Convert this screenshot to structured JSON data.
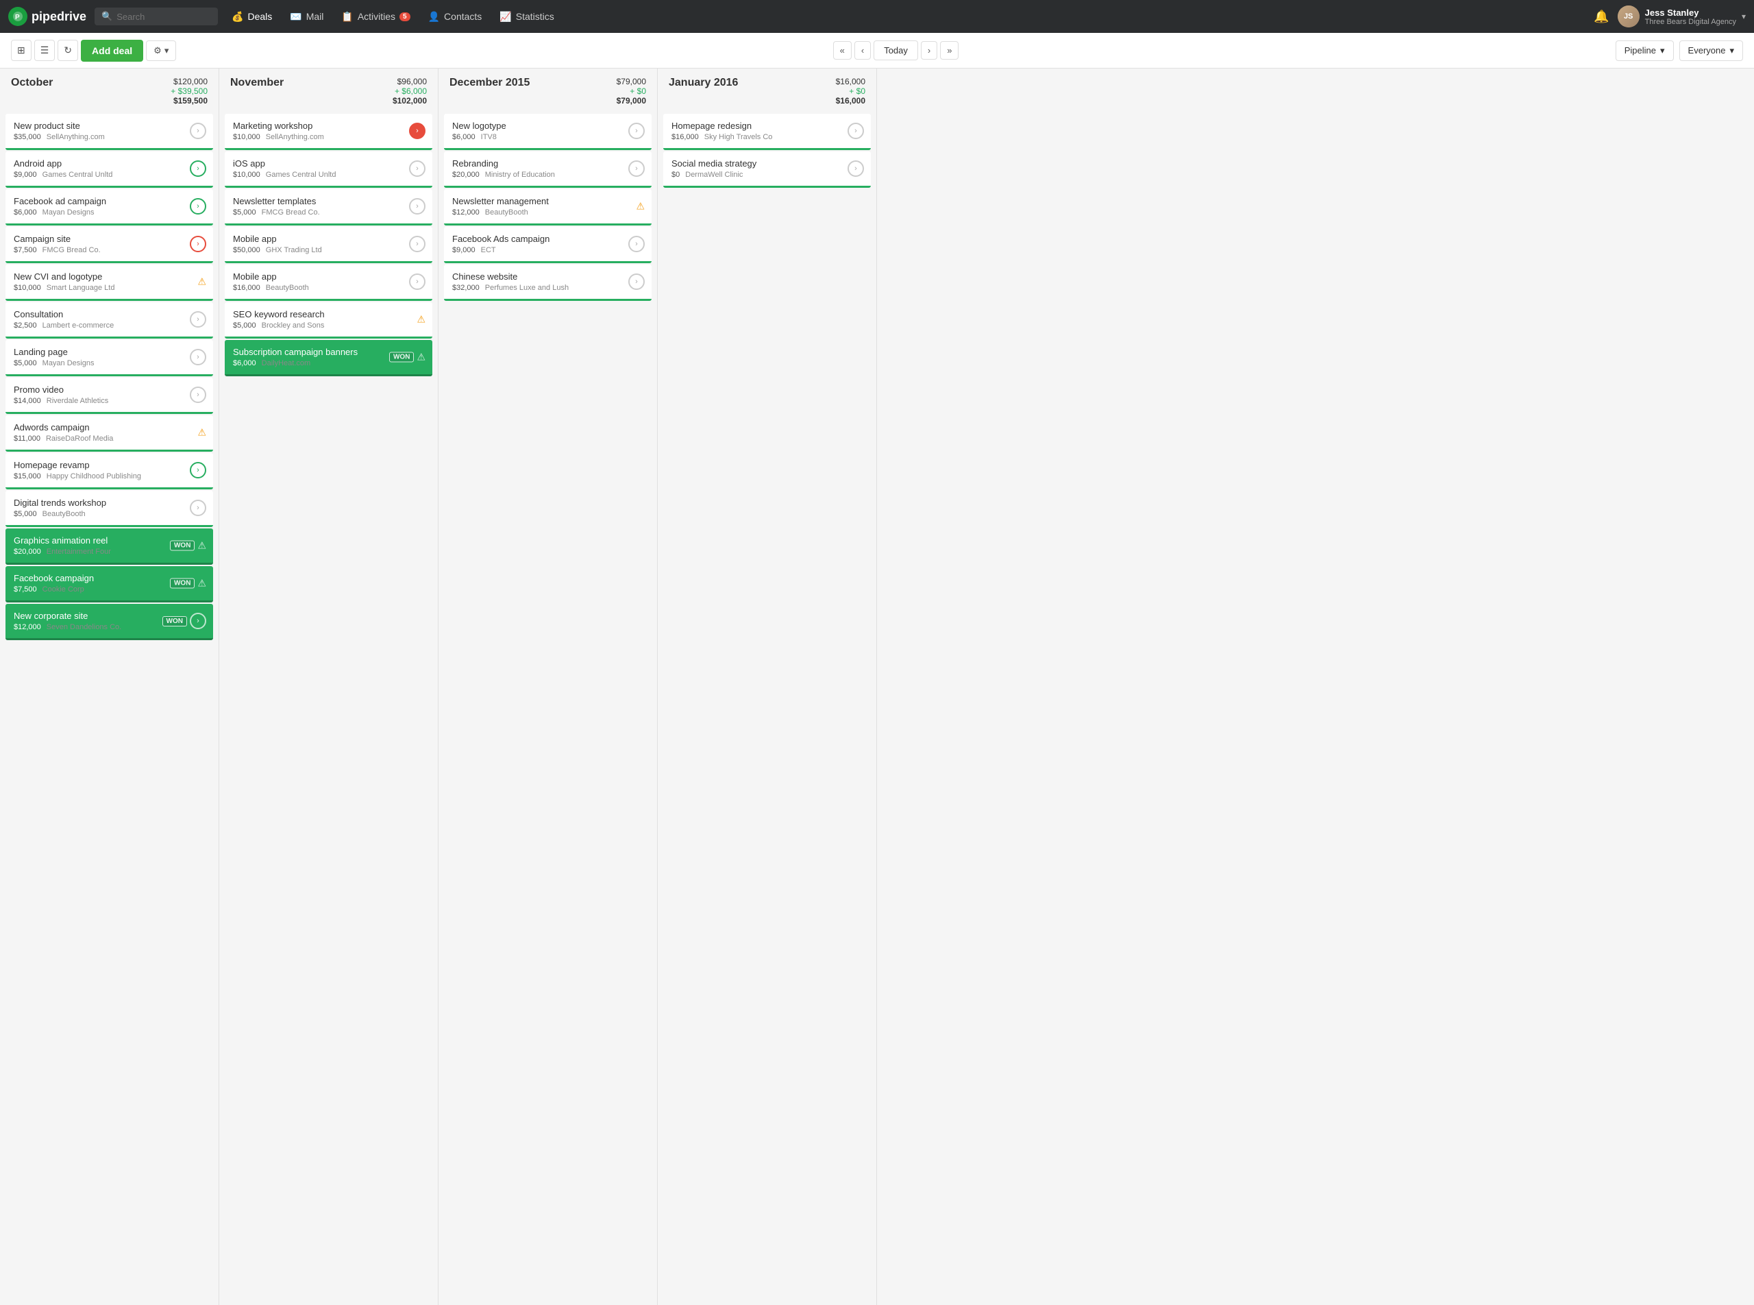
{
  "app": {
    "logo": "pipedrive",
    "logo_symbol": "P"
  },
  "nav": {
    "search_placeholder": "Search",
    "items": [
      {
        "id": "deals",
        "label": "Deals",
        "icon": "dollar-sign-icon",
        "active": true,
        "badge": null
      },
      {
        "id": "mail",
        "label": "Mail",
        "icon": "mail-icon",
        "active": false,
        "badge": null
      },
      {
        "id": "activities",
        "label": "Activities",
        "icon": "activity-icon",
        "active": false,
        "badge": "5"
      },
      {
        "id": "contacts",
        "label": "Contacts",
        "icon": "contacts-icon",
        "active": false,
        "badge": null
      },
      {
        "id": "statistics",
        "label": "Statistics",
        "icon": "statistics-icon",
        "active": false,
        "badge": null
      }
    ],
    "user": {
      "name": "Jess Stanley",
      "company": "Three Bears Digital Agency"
    }
  },
  "toolbar": {
    "add_deal_label": "Add deal",
    "today_label": "Today",
    "pipeline_label": "Pipeline",
    "everyone_label": "Everyone"
  },
  "columns": [
    {
      "id": "october",
      "title": "October",
      "amount_main": "$120,000",
      "amount_green": "+ $39,500",
      "amount_total": "$159,500",
      "deals": [
        {
          "name": "New product site",
          "amount": "$35,000",
          "company": "SellAnything.com",
          "status": "normal",
          "action": "grey-circle"
        },
        {
          "name": "Android app",
          "amount": "$9,000",
          "company": "Games Central Unltd",
          "status": "normal",
          "action": "green-arrow"
        },
        {
          "name": "Facebook ad campaign",
          "amount": "$6,000",
          "company": "Mayan Designs",
          "status": "normal",
          "action": "green-arrow"
        },
        {
          "name": "Campaign site",
          "amount": "$7,500",
          "company": "FMCG Bread Co.",
          "status": "normal",
          "action": "red-circle"
        },
        {
          "name": "New CVI and logotype",
          "amount": "$10,000",
          "company": "Smart Language Ltd",
          "status": "warning",
          "action": "warning"
        },
        {
          "name": "Consultation",
          "amount": "$2,500",
          "company": "Lambert e-commerce",
          "status": "normal",
          "action": "grey-circle"
        },
        {
          "name": "Landing page",
          "amount": "$5,000",
          "company": "Mayan Designs",
          "status": "normal",
          "action": "grey-circle"
        },
        {
          "name": "Promo video",
          "amount": "$14,000",
          "company": "Riverdale Athletics",
          "status": "normal",
          "action": "grey-circle"
        },
        {
          "name": "Adwords campaign",
          "amount": "$11,000",
          "company": "RaiseDaRoof Media",
          "status": "warning",
          "action": "warning"
        },
        {
          "name": "Homepage revamp",
          "amount": "$15,000",
          "company": "Happy Childhood Publishing",
          "status": "normal",
          "action": "green-arrow"
        },
        {
          "name": "Digital trends workshop",
          "amount": "$5,000",
          "company": "BeautyBooth",
          "status": "normal",
          "action": "grey-circle"
        },
        {
          "name": "Graphics animation reel",
          "amount": "$20,000",
          "company": "Entertainment Four",
          "status": "won",
          "action": "won-warning"
        },
        {
          "name": "Facebook campaign",
          "amount": "$7,500",
          "company": "Cookie Corp",
          "status": "won",
          "action": "won-warning"
        },
        {
          "name": "New corporate site",
          "amount": "$12,000",
          "company": "Seven Dandelions Co.",
          "status": "won",
          "action": "won-green-arrow"
        }
      ]
    },
    {
      "id": "november",
      "title": "November",
      "amount_main": "$96,000",
      "amount_green": "+ $6,000",
      "amount_total": "$102,000",
      "deals": [
        {
          "name": "Marketing workshop",
          "amount": "$10,000",
          "company": "SellAnything.com",
          "status": "normal",
          "action": "red-filled-circle"
        },
        {
          "name": "iOS app",
          "amount": "$10,000",
          "company": "Games Central Unltd",
          "status": "normal",
          "action": "grey-circle"
        },
        {
          "name": "Newsletter templates",
          "amount": "$5,000",
          "company": "FMCG Bread Co.",
          "status": "normal",
          "action": "grey-circle"
        },
        {
          "name": "Mobile app",
          "amount": "$50,000",
          "company": "GHX Trading Ltd",
          "status": "normal",
          "action": "grey-circle"
        },
        {
          "name": "Mobile app",
          "amount": "$16,000",
          "company": "BeautyBooth",
          "status": "normal",
          "action": "grey-circle"
        },
        {
          "name": "SEO keyword research",
          "amount": "$5,000",
          "company": "Brockley and Sons",
          "status": "warning",
          "action": "warning"
        },
        {
          "name": "Subscription campaign banners",
          "amount": "$6,000",
          "company": "DailyHeat.com",
          "status": "won",
          "action": "won-warning"
        }
      ]
    },
    {
      "id": "december",
      "title": "December 2015",
      "amount_main": "$79,000",
      "amount_green": "+ $0",
      "amount_total": "$79,000",
      "deals": [
        {
          "name": "New logotype",
          "amount": "$6,000",
          "company": "ITV8",
          "status": "normal",
          "action": "grey-circle"
        },
        {
          "name": "Rebranding",
          "amount": "$20,000",
          "company": "Ministry of Education",
          "status": "normal",
          "action": "grey-circle"
        },
        {
          "name": "Newsletter management",
          "amount": "$12,000",
          "company": "BeautyBooth",
          "status": "warning",
          "action": "warning"
        },
        {
          "name": "Facebook Ads campaign",
          "amount": "$9,000",
          "company": "ECT",
          "status": "normal",
          "action": "grey-circle"
        },
        {
          "name": "Chinese website",
          "amount": "$32,000",
          "company": "Perfumes Luxe and Lush",
          "status": "normal",
          "action": "grey-circle"
        }
      ]
    },
    {
      "id": "january",
      "title": "January 2016",
      "amount_main": "$16,000",
      "amount_green": "+ $0",
      "amount_total": "$16,000",
      "deals": [
        {
          "name": "Homepage redesign",
          "amount": "$16,000",
          "company": "Sky High Travels Co",
          "status": "normal",
          "action": "grey-circle"
        },
        {
          "name": "Social media strategy",
          "amount": "$0",
          "company": "DermaWell Clinic",
          "status": "normal",
          "action": "grey-circle"
        }
      ]
    }
  ]
}
